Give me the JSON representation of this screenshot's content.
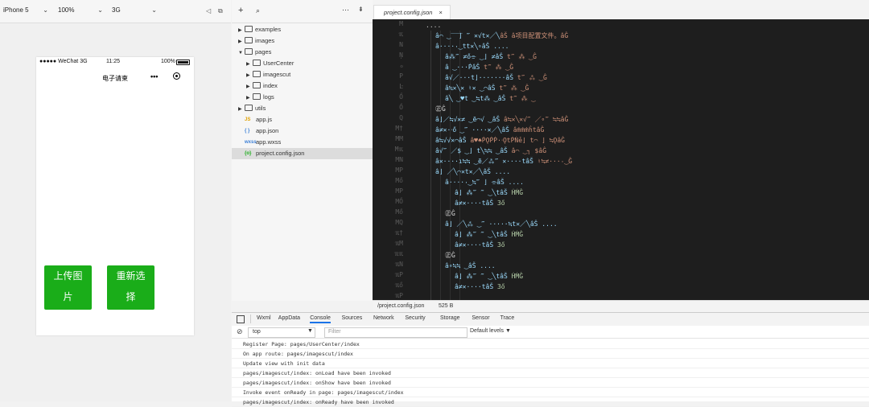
{
  "simulator": {
    "device": "iPhone 5",
    "zoom": "100%",
    "network": "3G",
    "status": {
      "carrier": "●●●●● WeChat 3G",
      "time": "11:25",
      "battery": "100%"
    },
    "nav_title": "电子请柬",
    "nav_more": "•••",
    "buttons": {
      "upload_line1": "上传图",
      "upload_line2": "片",
      "reselect_line1": "重新选",
      "reselect_line2": "择"
    }
  },
  "tree_toolbar": {
    "add": "+",
    "search": "⌕",
    "collapse": "⋯",
    "split": "⇟"
  },
  "file_tree": [
    {
      "label": "examples",
      "type": "folder",
      "expanded": false,
      "level": 0
    },
    {
      "label": "images",
      "type": "folder",
      "expanded": false,
      "level": 0
    },
    {
      "label": "pages",
      "type": "folder",
      "expanded": true,
      "level": 0
    },
    {
      "label": "UserCenter",
      "type": "folder",
      "expanded": false,
      "level": 1
    },
    {
      "label": "imagescut",
      "type": "folder",
      "expanded": false,
      "level": 1
    },
    {
      "label": "index",
      "type": "folder",
      "expanded": false,
      "level": 1
    },
    {
      "label": "logs",
      "type": "folder",
      "expanded": false,
      "level": 1
    },
    {
      "label": "utils",
      "type": "folder",
      "expanded": false,
      "level": 0
    },
    {
      "label": "app.js",
      "type": "js",
      "icon": "JS",
      "level": 0
    },
    {
      "label": "app.json",
      "type": "json",
      "icon": "{ }",
      "level": 0
    },
    {
      "label": "app.wxss",
      "type": "wxss",
      "icon": "wxss",
      "level": 0
    },
    {
      "label": "project.config.json",
      "type": "config",
      "icon": "{o}",
      "level": 0,
      "selected": true
    }
  ],
  "editor": {
    "tab_label": "project.config.json",
    "tab_close": "×",
    "status_path": "/project.config.json",
    "status_size": "525 B",
    "gutter": [
      "M",
      "ℼ",
      "N",
      "Ņ",
      "ℴ",
      "P",
      "Ŀ",
      "Ő",
      "Ő",
      "Q",
      "M†",
      "MM",
      "Mℼ",
      "MN",
      "MP",
      "Mő",
      "MP",
      "MŐ",
      "Mő",
      "MQ",
      "ℼ†",
      "ℼM",
      "ℼℼ",
      "ℼN",
      "ℼP",
      "ℼő",
      "ℼP"
    ],
    "lines": [
      {
        "indent": 0,
        "parts": [
          {
            "t": "....",
            "c": ""
          }
        ]
      },
      {
        "indent": 1,
        "parts": [
          {
            "t": "â⌒ ͜  ̅ ̅ ̅⌋ ‴ ✕√t✕／╲",
            "c": "k"
          },
          {
            "t": "âŠ â项目配置文件。âĜ",
            "c": "s"
          }
        ]
      },
      {
        "indent": 1,
        "parts": [
          {
            "t": "â·····͜ tt✕╲∘âŠ ....",
            "c": "k"
          }
        ]
      },
      {
        "indent": 2,
        "parts": [
          {
            "t": "â⁂‴ ≠ő⌯ ͜ ⌋ ≠âŠ ",
            "c": "k"
          },
          {
            "t": "t‴ ⁂ ͜ Ĝ",
            "c": "s"
          }
        ]
      },
      {
        "indent": 2,
        "parts": [
          {
            "t": "â ͜ ···ṖâŠ ",
            "c": "k"
          },
          {
            "t": "t‴ ⁂ ͜ Ĝ",
            "c": "s"
          }
        ]
      },
      {
        "indent": 2,
        "parts": [
          {
            "t": "â√／···t⌋·······âŠ ",
            "c": "k"
          },
          {
            "t": "t‴ ⁂ ͜ Ĝ",
            "c": "s"
          }
        ]
      },
      {
        "indent": 2,
        "parts": [
          {
            "t": "â≒✕╲✕ ♮✕ ͜ ⌒âŠ ",
            "c": "k"
          },
          {
            "t": "t‴ ⁂ ͜ Ĝ",
            "c": "s"
          }
        ]
      },
      {
        "indent": 2,
        "parts": [
          {
            "t": "â╲ ͜ ♥t ͜ ≒t⁂ ͜ âŠ ",
            "c": "k"
          },
          {
            "t": "t‴ ⁂ ͜",
            "c": "s"
          }
        ]
      },
      {
        "indent": 1,
        "parts": [
          {
            "t": "㊣Ĝ",
            "c": ""
          }
        ]
      },
      {
        "indent": 1,
        "parts": [
          {
            "t": "â⌋／≒√✕≠ ͜ ẽ⌒√ ͜ âŠ ",
            "c": "k"
          },
          {
            "t": "â≒✕╲✕√‴ ／∘‴ ≒≒âĜ",
            "c": "s"
          }
        ]
      },
      {
        "indent": 1,
        "parts": [
          {
            "t": "â≠✕·ᐧő ͜ ‴ ····✕／╲âŠ ",
            "c": "k"
          },
          {
            "t": "âṁṁṁĥtâĜ",
            "c": "s"
          }
        ]
      },
      {
        "indent": 1,
        "parts": [
          {
            "t": "â≒√√✕⌒âŠ ",
            "c": "k"
          },
          {
            "t": "â♥♠ṖǪṖṖ·ᐧǪtṖṄẻ⌋ t⌒ ⌋ ≒ǪâĜ",
            "c": "s"
          }
        ]
      },
      {
        "indent": 1,
        "parts": [
          {
            "t": "â√‴ ／$ ͜ ⌋ t╲≒≒ ͜ âŠ ",
            "c": "k"
          },
          {
            "t": "â⌒ ͜ ┐ $âĜ",
            "c": "s"
          }
        ]
      },
      {
        "indent": 1,
        "parts": [
          {
            "t": "â✕····ı≒≒ ͜ ẽ／⁂‴ ✕····tâŠ ",
            "c": "k"
          },
          {
            "t": "♮≒≠····͜ Ĝ",
            "c": "s"
          }
        ]
      },
      {
        "indent": 1,
        "parts": [
          {
            "t": "â⌋ ／╲⌒✕t✕／╲âŠ ....",
            "c": "k"
          }
        ]
      },
      {
        "indent": 2,
        "parts": [
          {
            "t": "â·····͜ ≒‴ ⌋ ⌯âŠ ....",
            "c": "k"
          }
        ]
      },
      {
        "indent": 3,
        "parts": [
          {
            "t": "â⌋ ⁂‴ ‴ ͜ ╲tâŠ ",
            "c": "k"
          },
          {
            "t": "ḢṀĜ",
            "c": "n"
          }
        ]
      },
      {
        "indent": 3,
        "parts": [
          {
            "t": "â≠✕····tâŠ ",
            "c": "k"
          },
          {
            "t": "3ő",
            "c": "n"
          }
        ]
      },
      {
        "indent": 2,
        "parts": [
          {
            "t": "㊣Ĝ",
            "c": ""
          }
        ]
      },
      {
        "indent": 2,
        "parts": [
          {
            "t": "â⌋ ／╲⁂ ͜ ‴ ·····≒t✕／╲âŠ ....",
            "c": "k"
          }
        ]
      },
      {
        "indent": 3,
        "parts": [
          {
            "t": "â⌋ ⁂‴ ‴ ͜ ╲tâŠ ",
            "c": "k"
          },
          {
            "t": "ḢṀĜ",
            "c": "n"
          }
        ]
      },
      {
        "indent": 3,
        "parts": [
          {
            "t": "â≠✕····tâŠ ",
            "c": "k"
          },
          {
            "t": "3ő",
            "c": "n"
          }
        ]
      },
      {
        "indent": 2,
        "parts": [
          {
            "t": "㊣Ĝ",
            "c": ""
          }
        ]
      },
      {
        "indent": 2,
        "parts": [
          {
            "t": "â∘≒≒ ͜ âŠ ....",
            "c": "k"
          }
        ]
      },
      {
        "indent": 3,
        "parts": [
          {
            "t": "â⌋ ⁂‴ ‴ ͜ ╲tâŠ ",
            "c": "k"
          },
          {
            "t": "ḢṀĜ",
            "c": "n"
          }
        ]
      },
      {
        "indent": 3,
        "parts": [
          {
            "t": "â≠✕····tâŠ ",
            "c": "k"
          },
          {
            "t": "3ő",
            "c": "n"
          }
        ]
      }
    ]
  },
  "devtools": {
    "tabs": [
      "Wxml",
      "AppData",
      "Console",
      "Sources",
      "Network",
      "Security",
      "Storage",
      "Sensor",
      "Trace"
    ],
    "active_tab": "Console",
    "context": "top",
    "filter_placeholder": "Filter",
    "levels": "Default levels ▼",
    "logs": [
      "Register Page: pages/UserCenter/index",
      "On app route: pages/imagescut/index",
      "Update view with init data",
      "pages/imagescut/index: onLoad have been invoked",
      "pages/imagescut/index: onShow have been invoked",
      "Invoke event onReady in page: pages/imagescut/index",
      "pages/imagescut/index: onReady have been invoked"
    ]
  }
}
